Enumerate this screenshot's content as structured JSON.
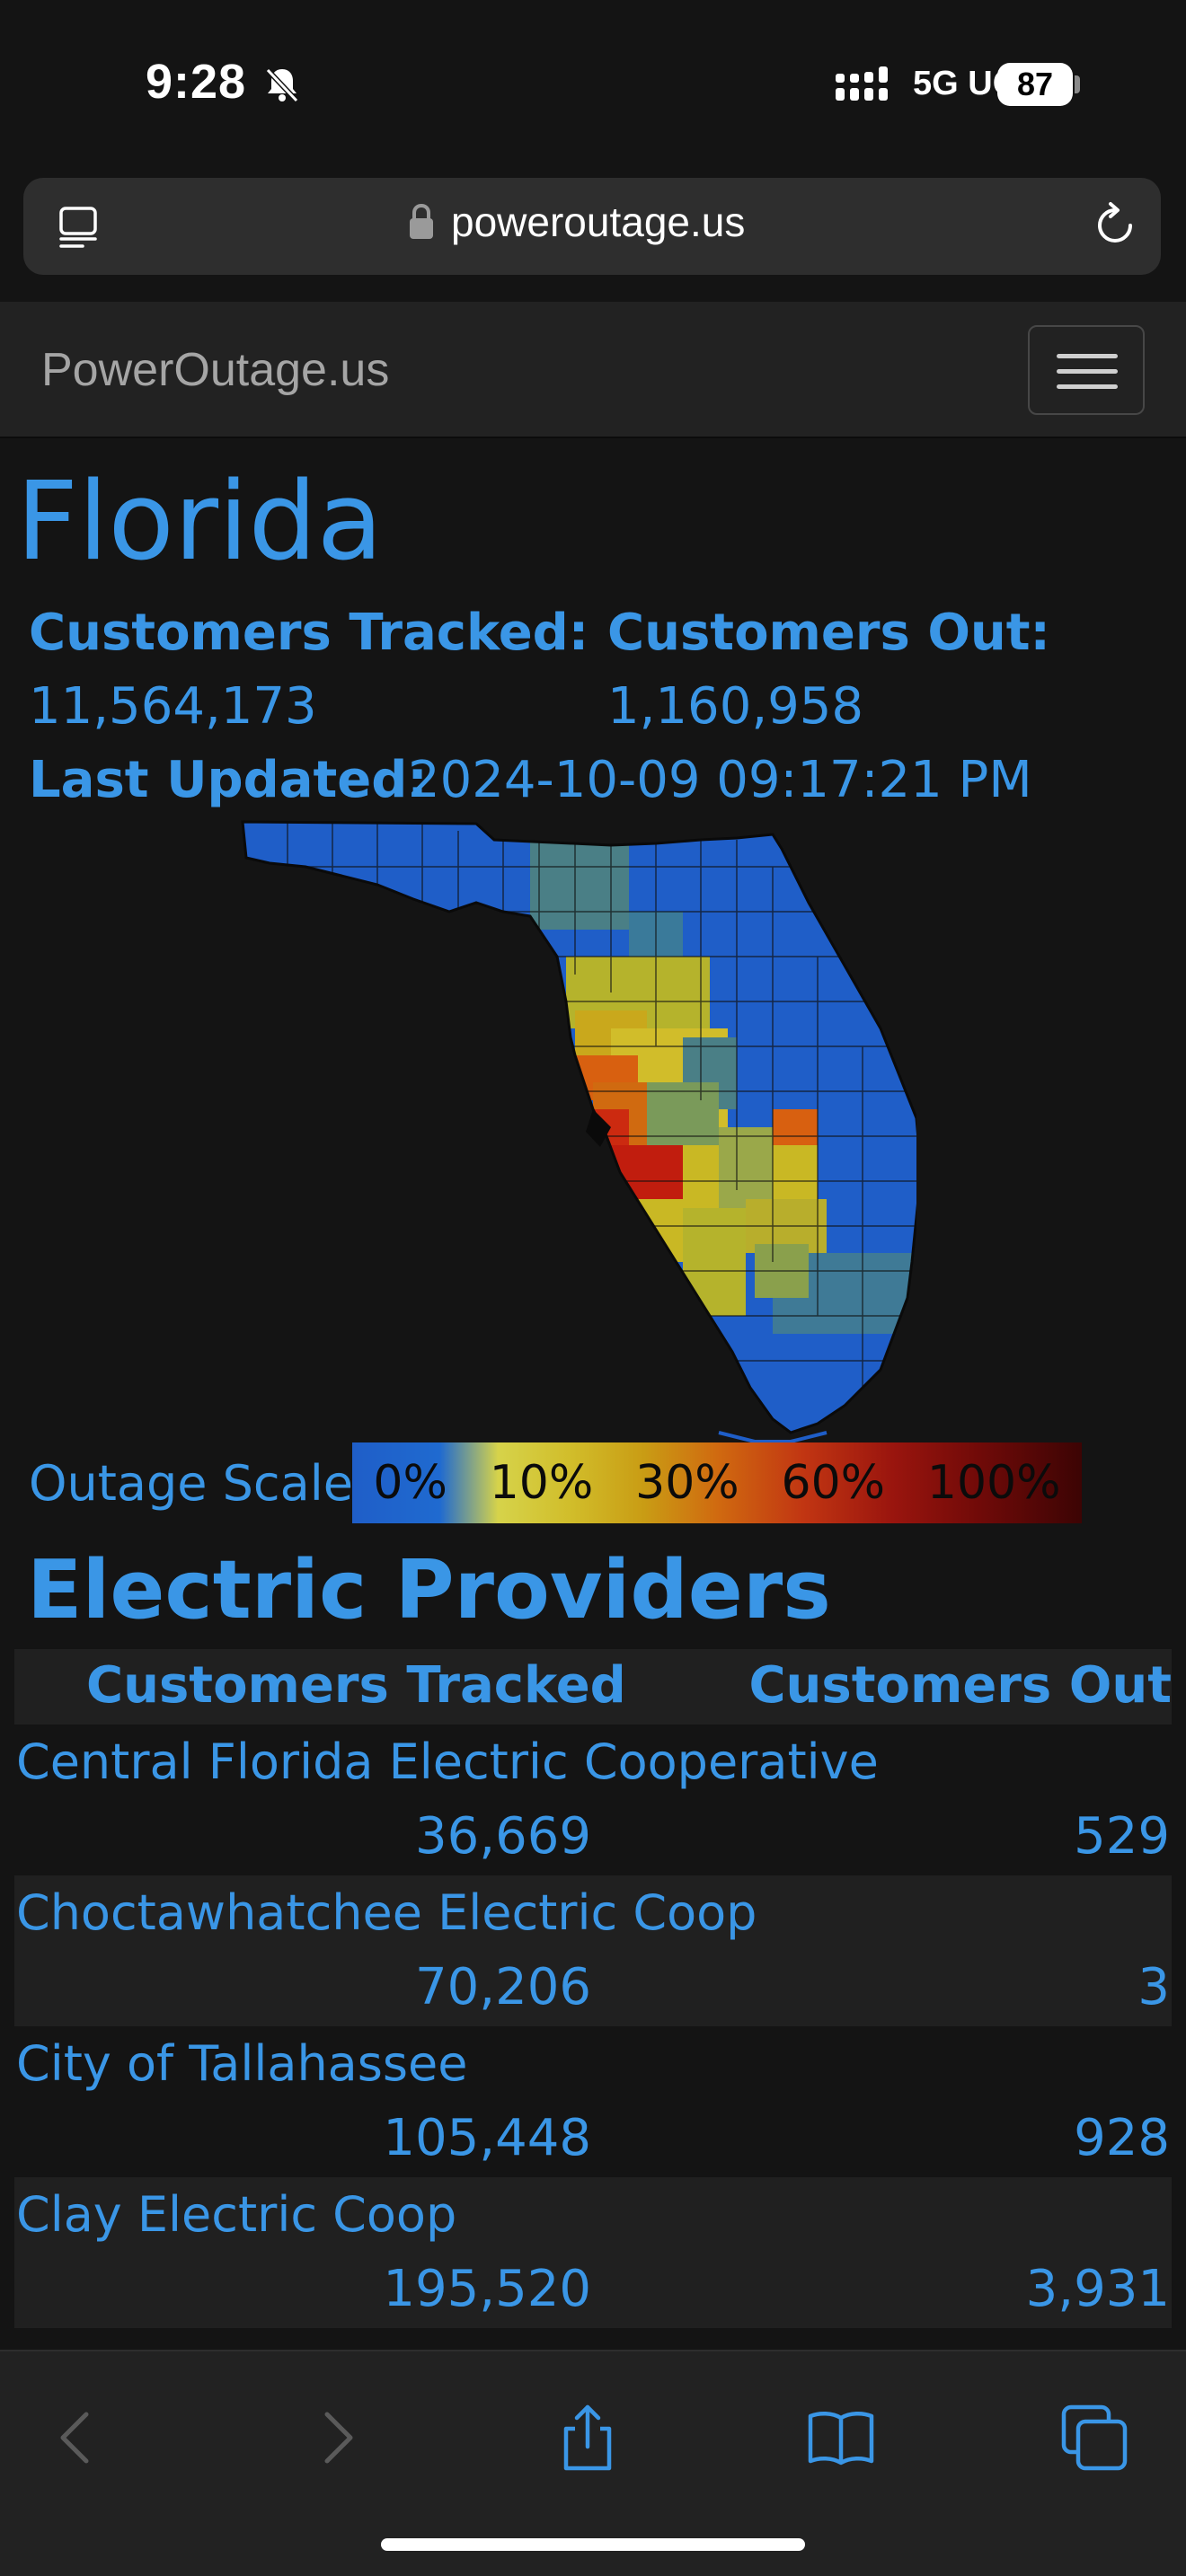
{
  "status_bar": {
    "time": "9:28",
    "network": "5G UC",
    "battery": "87"
  },
  "browser": {
    "url": "poweroutage.us"
  },
  "navbar": {
    "brand": "PowerOutage.us"
  },
  "state": {
    "title": "Florida",
    "customers_tracked_label": "Customers Tracked:",
    "customers_tracked_value": "11,564,173",
    "customers_out_label": "Customers Out:",
    "customers_out_value": "1,160,958",
    "last_updated_label": "Last Updated:",
    "last_updated_value": "2024-10-09 09:17:21 PM"
  },
  "scale": {
    "label": "Outage Scale:",
    "stops": [
      "0%",
      "10%",
      "30%",
      "60%",
      "100%"
    ],
    "colors": [
      "#1f5ec8",
      "#d6d34a",
      "#d06a10",
      "#c13512",
      "#3c0404"
    ]
  },
  "providers": {
    "title": "Electric Providers",
    "columns": [
      "Customers Tracked",
      "Customers Out"
    ],
    "rows": [
      {
        "name": "Central Florida Electric Cooperative",
        "tracked": "36,669",
        "out": "529"
      },
      {
        "name": "Choctawhatchee Electric Coop",
        "tracked": "70,206",
        "out": "3"
      },
      {
        "name": "City of Tallahassee",
        "tracked": "105,448",
        "out": "928"
      },
      {
        "name": "Clay Electric Coop",
        "tracked": "195,520",
        "out": "3,931"
      }
    ]
  },
  "toolbar": {
    "icons": [
      "back-icon",
      "forward-icon",
      "share-icon",
      "bookmarks-icon",
      "tabs-icon"
    ]
  }
}
